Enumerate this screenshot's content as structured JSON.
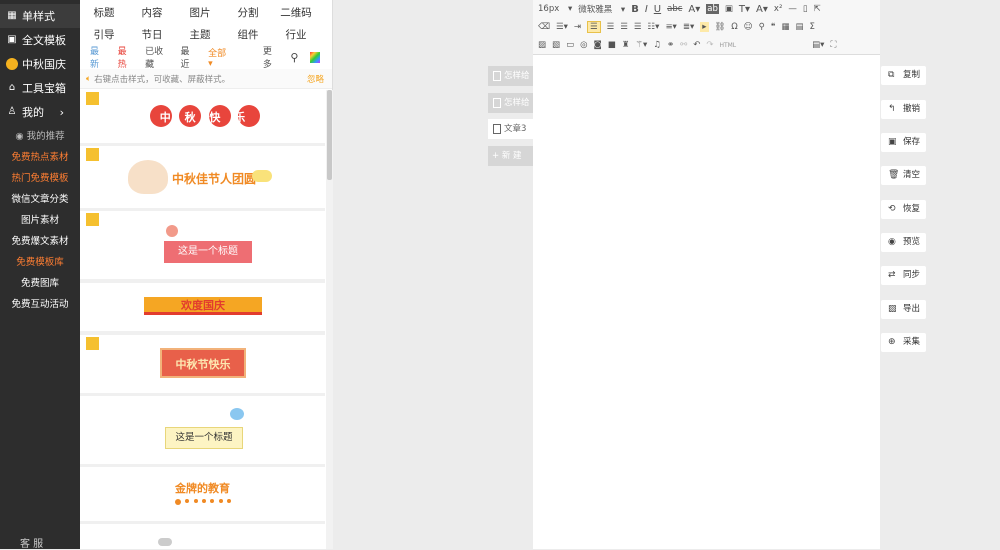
{
  "sidebar": {
    "top_items": [
      {
        "label": "单样式",
        "icon": "grid-icon"
      },
      {
        "label": "全文模板",
        "icon": "template-icon"
      },
      {
        "label": "中秋国庆",
        "icon": "moon-icon"
      },
      {
        "label": "工具宝箱",
        "icon": "toolbox-icon"
      },
      {
        "label": "我的",
        "icon": "user-icon"
      }
    ],
    "sub_items": [
      {
        "label": "我的推荐"
      },
      {
        "label": "免费热点素材"
      },
      {
        "label": "热门免费模板"
      },
      {
        "label": "微信文章分类"
      },
      {
        "label": "图片素材"
      },
      {
        "label": "免费爆文素材"
      },
      {
        "label": "免费模板库"
      },
      {
        "label": "免费图库"
      },
      {
        "label": "免费互动活动"
      }
    ],
    "bottom_label": "客 服"
  },
  "panel": {
    "categories_row1": [
      "标题",
      "内容",
      "图片",
      "分割",
      "二维码"
    ],
    "categories_row2": [
      "引导",
      "节日",
      "主题",
      "组件",
      "行业"
    ],
    "filters": [
      "最新",
      "最热",
      "已收藏",
      "最近",
      "全部",
      "更多"
    ],
    "tip": "右键点击样式，可收藏、屏蔽样式。",
    "tip_ignore": "忽略",
    "cards": [
      {
        "text": "中 秋 快 乐"
      },
      {
        "text": "中秋佳节人团圆"
      },
      {
        "text": "这是一个标题"
      },
      {
        "text": "欢度国庆"
      },
      {
        "text": "中秋节快乐"
      },
      {
        "text": "这是一个标题"
      },
      {
        "text": "金牌的教育"
      }
    ]
  },
  "tabs": [
    {
      "label": "怎样给"
    },
    {
      "label": "怎样给"
    },
    {
      "label": "文章3"
    },
    {
      "label": "+ 新 建"
    }
  ],
  "toolbar": {
    "font_size": "16px",
    "font_family": "微软雅黑",
    "html_label": "HTML"
  },
  "actions": [
    {
      "label": "复制",
      "icon": "copy-icon"
    },
    {
      "label": "撤销",
      "icon": "undo-icon"
    },
    {
      "label": "保存",
      "icon": "save-icon"
    },
    {
      "label": "清空",
      "icon": "trash-icon"
    },
    {
      "label": "恢复",
      "icon": "restore-icon"
    },
    {
      "label": "预览",
      "icon": "eye-icon"
    },
    {
      "label": "同步",
      "icon": "sync-icon"
    },
    {
      "label": "导出",
      "icon": "export-icon"
    },
    {
      "label": "采集",
      "icon": "collect-icon"
    }
  ]
}
